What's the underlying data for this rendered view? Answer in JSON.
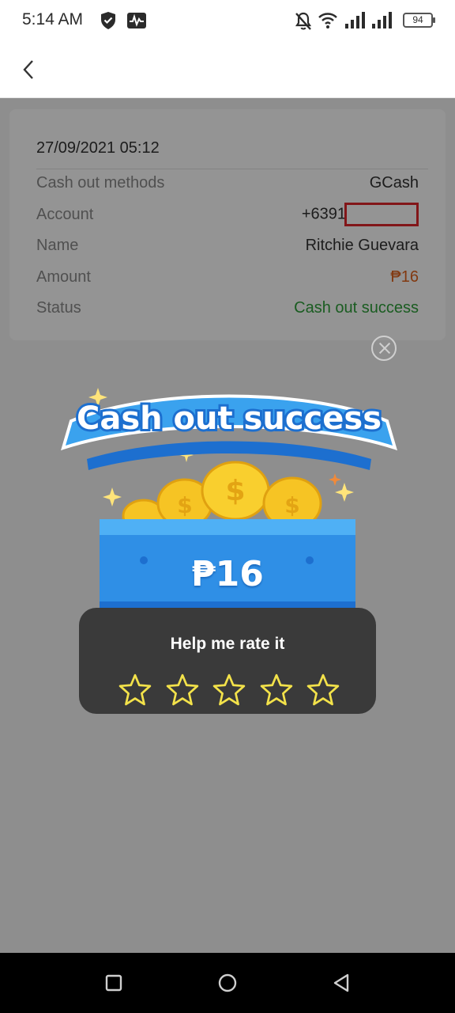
{
  "status_bar": {
    "time": "5:14 AM",
    "battery": "94",
    "icons": [
      "shield-check-icon",
      "activity-icon",
      "bell-off-icon",
      "wifi-icon",
      "signal-icon",
      "signal-icon",
      "battery-icon"
    ]
  },
  "header": {
    "back_icon": "chevron-left-icon"
  },
  "record": {
    "date": "27/09/2021 05:12",
    "rows": [
      {
        "label": "Cash out methods",
        "value": "GCash"
      },
      {
        "label": "Account",
        "value": "+6391"
      },
      {
        "label": "Name",
        "value": "Ritchie Guevara"
      },
      {
        "label": "Amount",
        "value": "₱16"
      },
      {
        "label": "Status",
        "value": "Cash out success"
      }
    ]
  },
  "popup": {
    "banner_title": "Cash out success",
    "amount": "₱16",
    "rate_title": "Help me rate it",
    "star_count": 5
  },
  "colors": {
    "amount": "#e0621d",
    "status_success": "#2e9f3a",
    "ticket_blue": "#2f8fe6",
    "coin_gold": "#f6c424",
    "star_outline": "#f3e24a"
  },
  "nav": {
    "icons": [
      "square-icon",
      "circle-icon",
      "triangle-back-icon"
    ]
  }
}
